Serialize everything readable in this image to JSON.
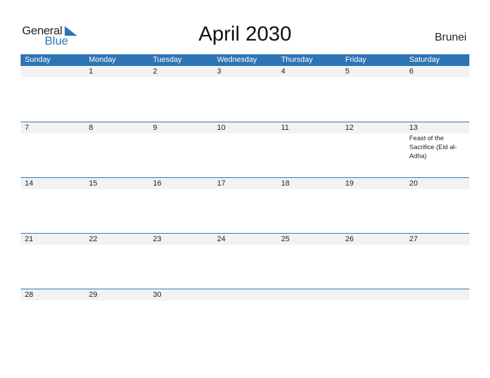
{
  "logo": {
    "general": "General",
    "blue": "Blue",
    "icon": "triangle-flag-icon"
  },
  "header": {
    "title": "April 2030",
    "country": "Brunei"
  },
  "colors": {
    "accent": "#2e74b5",
    "band": "#f2f2f2"
  },
  "days": [
    "Sunday",
    "Monday",
    "Tuesday",
    "Wednesday",
    "Thursday",
    "Friday",
    "Saturday"
  ],
  "weeks": [
    [
      {
        "day": ""
      },
      {
        "day": "1"
      },
      {
        "day": "2"
      },
      {
        "day": "3"
      },
      {
        "day": "4"
      },
      {
        "day": "5"
      },
      {
        "day": "6"
      }
    ],
    [
      {
        "day": "7"
      },
      {
        "day": "8"
      },
      {
        "day": "9"
      },
      {
        "day": "10"
      },
      {
        "day": "11"
      },
      {
        "day": "12"
      },
      {
        "day": "13",
        "event": "Feast of the Sacrifice (Eid al-Adha)"
      }
    ],
    [
      {
        "day": "14"
      },
      {
        "day": "15"
      },
      {
        "day": "16"
      },
      {
        "day": "17"
      },
      {
        "day": "18"
      },
      {
        "day": "19"
      },
      {
        "day": "20"
      }
    ],
    [
      {
        "day": "21"
      },
      {
        "day": "22"
      },
      {
        "day": "23"
      },
      {
        "day": "24"
      },
      {
        "day": "25"
      },
      {
        "day": "26"
      },
      {
        "day": "27"
      }
    ],
    [
      {
        "day": "28"
      },
      {
        "day": "29"
      },
      {
        "day": "30"
      },
      {
        "day": ""
      },
      {
        "day": ""
      },
      {
        "day": ""
      },
      {
        "day": ""
      }
    ]
  ]
}
